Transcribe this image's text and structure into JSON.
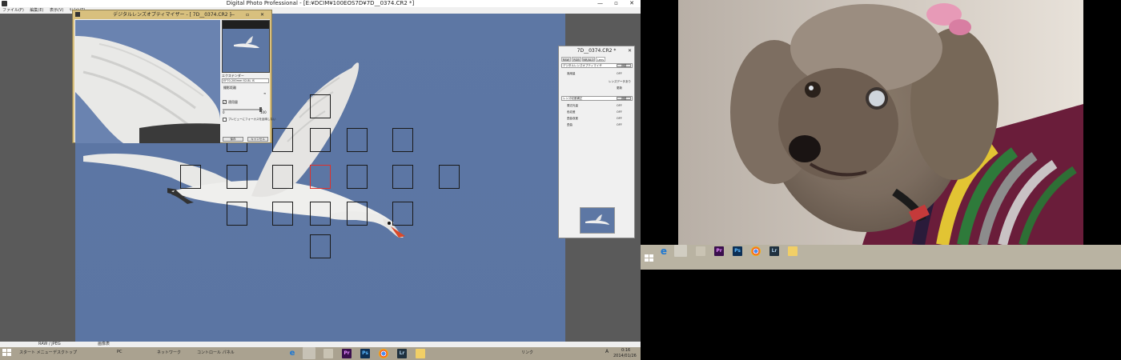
{
  "left_screen": {
    "window_title": "Digital Photo Professional - [E:¥DCIM¥100EOS7D¥7D__0374.CR2 *]",
    "title_controls": "— ▫ ✕",
    "menu": [
      "ファイル(F)",
      "編集(E)",
      "表示(V)",
      "ｻﾑﾈｲﾙ(T)"
    ],
    "status": {
      "left": "RAW / JPEG",
      "right": "画像表"
    },
    "taskbar": {
      "start_label": "スタート メニュー",
      "items": [
        "デスクトップ",
        "PC",
        "ネットワーク",
        "コントロール パネル"
      ],
      "extra_text": "リンク",
      "clock_time": "0:16",
      "clock_date": "2014/01/26",
      "ime": "A"
    }
  },
  "dlo_dialog": {
    "title": "デジタルレンズオプティマイザー - [ 7D__0374.CR2 ]",
    "lens_label": "エクステンダー",
    "lens_value": "EF70-200mm f/2.8L IS",
    "shooting_distance_label": "撮影距離",
    "distance_value": "∞",
    "apply_label": "適用量",
    "apply_range_min": "0",
    "apply_range_max": "100",
    "preview_checkbox_label": "プレビューにフォーカスを反映しない",
    "ok_button": "保存",
    "cancel_button": "キャンセル",
    "controls": "— ▫ ✕"
  },
  "tool_palette": {
    "title": "7D__0374.CR2 *",
    "close": "✕",
    "tabs": [
      "RAW",
      "RGB",
      "NR/ALO",
      "Lens"
    ],
    "section1": {
      "label": "デジタルレンズオプティマイザ",
      "button": "詳細"
    },
    "row_apply": {
      "label": "適用量",
      "value": "OFF"
    },
    "lens_data_label": "レンズデータ",
    "lens_data_value": "あり",
    "update_button": "更新",
    "section2": {
      "label": "レンズ収差補正",
      "button": "詳細"
    },
    "rows": [
      {
        "label": "周辺光量",
        "value": "OFF"
      },
      {
        "label": "色収差",
        "value": "OFF"
      },
      {
        "label": "歪曲収差",
        "value": "OFF"
      },
      {
        "label": "歪曲",
        "value": "OFF"
      }
    ]
  },
  "right_screen": {
    "taskbar_icons": [
      "start-icon",
      "ie-icon",
      "app-icon",
      "explorer-icon",
      "premiere-icon",
      "photoshop-icon",
      "chrome-icon",
      "lightroom-icon",
      "folder-icon"
    ]
  },
  "icon_glyphs": {
    "premiere": "Pr",
    "photoshop": "Ps",
    "lightroom": "Lr",
    "ie": "e"
  },
  "colors": {
    "sky_blue": "#5b75a3",
    "af_active": "#e0302a",
    "taskbar": "#aaa290",
    "dialog_frame": "#d8c07e"
  }
}
